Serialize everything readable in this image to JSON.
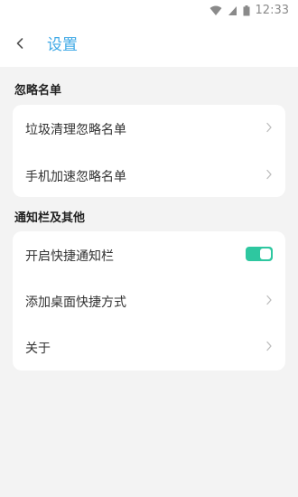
{
  "status_bar": {
    "time": "12:33"
  },
  "header": {
    "title": "设置"
  },
  "sections": [
    {
      "label": "忽略名单",
      "rows": [
        {
          "label": "垃圾清理忽略名单"
        },
        {
          "label": "手机加速忽略名单"
        }
      ]
    },
    {
      "label": "通知栏及其他",
      "rows": [
        {
          "label": "开启快捷通知栏",
          "toggle_on": true
        },
        {
          "label": "添加桌面快捷方式"
        },
        {
          "label": "关于"
        }
      ]
    }
  ],
  "colors": {
    "accent": "#3fa9e6",
    "toggle_on": "#2ec7a0",
    "background": "#f3f3f3",
    "card": "#ffffff"
  }
}
